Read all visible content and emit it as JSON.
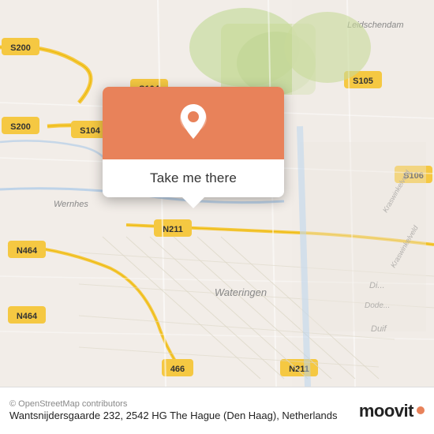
{
  "map": {
    "alt": "Map of The Hague Netherlands"
  },
  "popup": {
    "button_label": "Take me there",
    "pin_color": "#e8825a"
  },
  "footer": {
    "address": "Wantsnijdersgaarde 232, 2542 HG The Hague (Den Haag), Netherlands",
    "copyright": "© OpenStreetMap contributors",
    "logo_text": "moovit"
  }
}
